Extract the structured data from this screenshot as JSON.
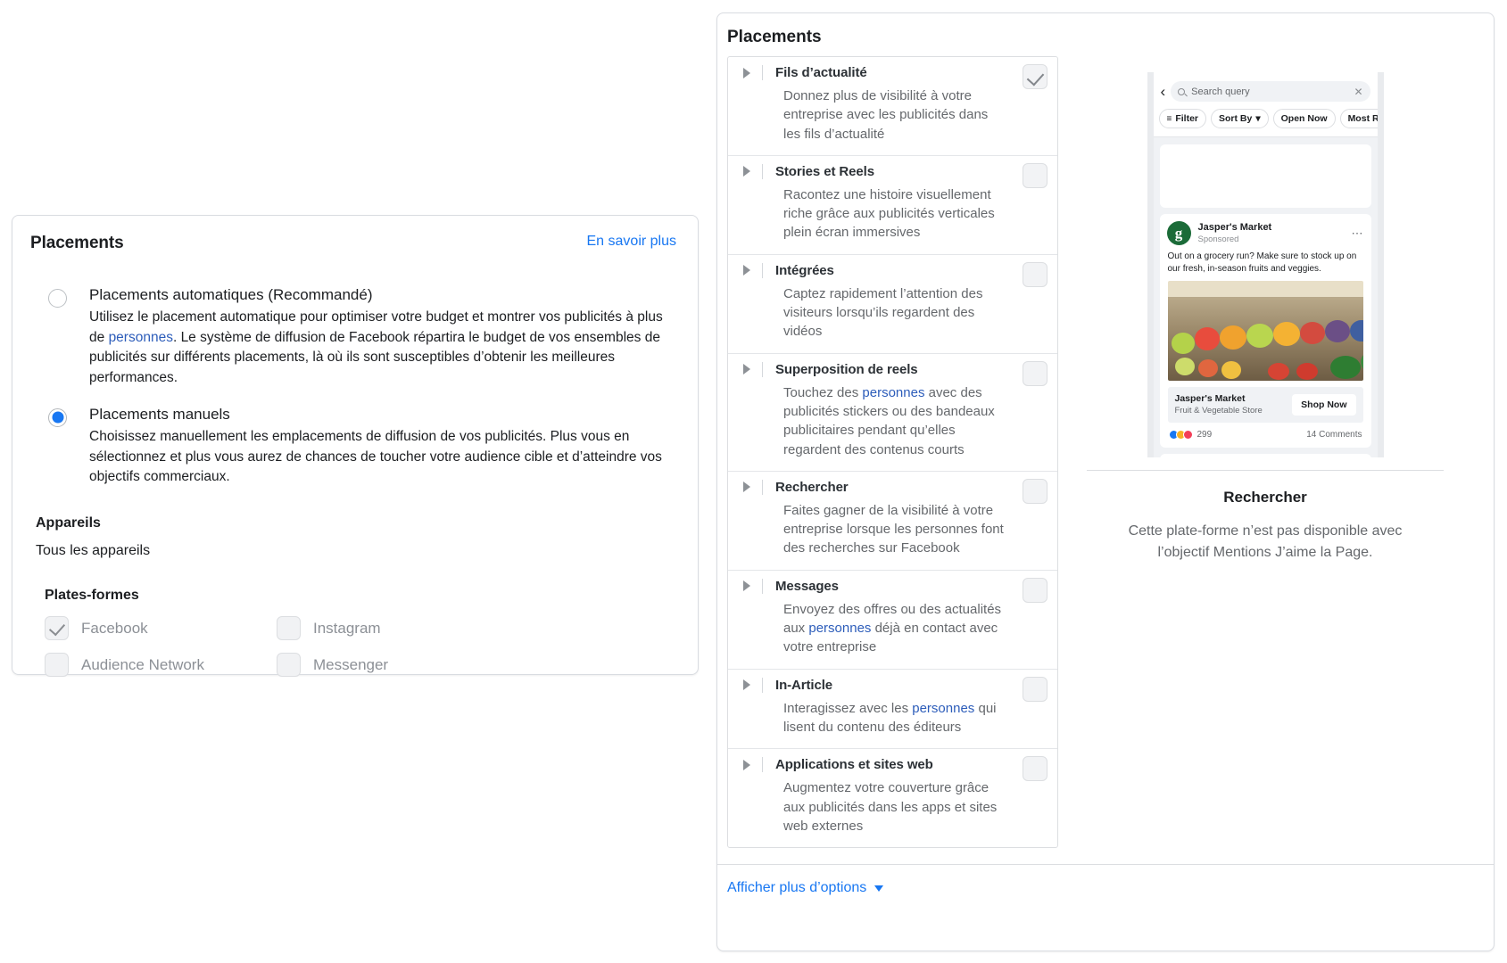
{
  "left_panel": {
    "title": "Placements",
    "learn_more": "En savoir plus",
    "options": [
      {
        "label": "Placements automatiques (Recommandé)",
        "selected": false,
        "desc_before": "Utilisez le placement automatique pour optimiser votre budget et montrer vos publicités à plus de ",
        "desc_link": "personnes",
        "desc_after": ". Le système de diffusion de Facebook répartira le budget de vos ensembles de publicités sur différents placements, là où ils sont susceptibles d’obtenir les meilleures performances."
      },
      {
        "label": "Placements manuels",
        "selected": true,
        "desc_before": "Choisissez manuellement les emplacements de diffusion de vos publicités. Plus vous en sélectionnez et plus vous aurez de chances de toucher votre audience cible et d’atteindre vos objectifs commerciaux.",
        "desc_link": "",
        "desc_after": ""
      }
    ],
    "devices_label": "Appareils",
    "devices_value": "Tous les appareils",
    "platforms_label": "Plates-formes",
    "platforms": [
      {
        "label": "Facebook",
        "checked": true
      },
      {
        "label": "Instagram",
        "checked": false
      },
      {
        "label": "Audience Network",
        "checked": false
      },
      {
        "label": "Messenger",
        "checked": false
      }
    ]
  },
  "right_panel": {
    "title": "Placements",
    "more_options": "Afficher plus d’options",
    "placements": [
      {
        "name": "Fils d’actualité",
        "checked": true,
        "desc_parts": [
          {
            "text": "Donnez plus de visibilité à votre entreprise avec les publicités dans les fils d’actualité",
            "link": false
          }
        ]
      },
      {
        "name": "Stories et Reels",
        "checked": false,
        "desc_parts": [
          {
            "text": "Racontez une histoire visuellement riche grâce aux publicités verticales plein écran immersives",
            "link": false
          }
        ]
      },
      {
        "name": "Intégrées",
        "checked": false,
        "desc_parts": [
          {
            "text": "Captez rapidement l’attention des visiteurs lorsqu’ils regardent des vidéos",
            "link": false
          }
        ]
      },
      {
        "name": "Superposition de reels",
        "checked": false,
        "desc_parts": [
          {
            "text": "Touchez des ",
            "link": false
          },
          {
            "text": "personnes",
            "link": true
          },
          {
            "text": " avec des publicités stickers ou des bandeaux publicitaires pendant qu’elles regardent des contenus courts",
            "link": false
          }
        ]
      },
      {
        "name": "Rechercher",
        "checked": false,
        "desc_parts": [
          {
            "text": "Faites gagner de la visibilité à votre entreprise lorsque les personnes font des recherches sur Facebook",
            "link": false
          }
        ]
      },
      {
        "name": "Messages",
        "checked": false,
        "desc_parts": [
          {
            "text": "Envoyez des offres ou des actualités aux ",
            "link": false
          },
          {
            "text": "personnes",
            "link": true
          },
          {
            "text": " déjà en contact avec votre entreprise",
            "link": false
          }
        ]
      },
      {
        "name": "In-Article",
        "checked": false,
        "desc_parts": [
          {
            "text": "Interagissez avec les ",
            "link": false
          },
          {
            "text": "personnes",
            "link": true
          },
          {
            "text": " qui lisent du contenu des éditeurs",
            "link": false
          }
        ]
      },
      {
        "name": "Applications et sites web",
        "checked": false,
        "desc_parts": [
          {
            "text": "Augmentez votre couverture grâce aux publicités dans les apps et sites web externes",
            "link": false
          }
        ]
      }
    ],
    "preview": {
      "phone": {
        "search_placeholder": "Search query",
        "chips": [
          "Filter",
          "Sort By",
          "Open Now",
          "Most Rec"
        ],
        "ad": {
          "brand": "Jasper's Market",
          "sponsored": "Sponsored",
          "avatar_letter": "g",
          "copy": "Out on a grocery run? Make sure to stock up on our fresh, in-season fruits and veggies.",
          "cta_title": "Jasper's Market",
          "cta_subtitle": "Fruit & Vegetable Store",
          "cta_button": "Shop Now",
          "reactions_count": "299",
          "comments": "14 Comments"
        }
      },
      "title": "Rechercher",
      "note": "Cette plate-forme n’est pas disponible avec l’objectif Mentions J’aime la Page."
    }
  },
  "colors": {
    "link_blue": "#1877f2",
    "text_dark": "#1c1e21",
    "text_muted": "#65686c",
    "border": "#dcdee1"
  }
}
